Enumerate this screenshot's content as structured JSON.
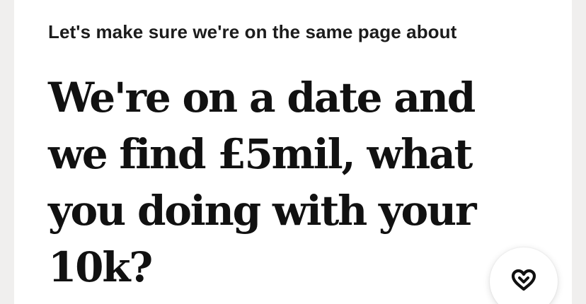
{
  "prompt": {
    "label": "Let's make sure we're on the same page about",
    "answer": "We're on a date and we find £5mil, what you doing with your 10k?"
  },
  "actions": {
    "like_icon": "heart-outline-icon"
  },
  "colors": {
    "card_background": "#ffffff",
    "text_primary": "#111111"
  }
}
